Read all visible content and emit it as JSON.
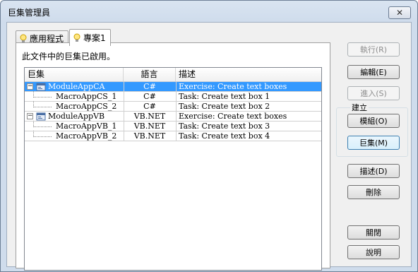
{
  "window": {
    "title": "巨集管理員"
  },
  "tabs": [
    {
      "label": "應用程式",
      "active": false
    },
    {
      "label": "專案1",
      "active": true
    }
  ],
  "status_text": "此文件中的巨集已啟用。",
  "columns": [
    "巨集",
    "語言",
    "描述"
  ],
  "rows": [
    {
      "name": "ModuleAppCA",
      "lang": "C#",
      "desc": "Exercise: Create text boxes",
      "level": 0,
      "selected": true
    },
    {
      "name": "MacroAppCS_1",
      "lang": "C#",
      "desc": "Task: Create text box 1",
      "level": 1,
      "selected": false
    },
    {
      "name": "MacroAppCS_2",
      "lang": "C#",
      "desc": "Task: Create text box 2",
      "level": 1,
      "selected": false
    },
    {
      "name": "ModuleAppVB",
      "lang": "VB.NET",
      "desc": "Exercise: Create text boxes",
      "level": 0,
      "selected": false
    },
    {
      "name": "MacroAppVB_1",
      "lang": "VB.NET",
      "desc": "Task: Create text box 3",
      "level": 1,
      "selected": false
    },
    {
      "name": "MacroAppVB_2",
      "lang": "VB.NET",
      "desc": "Task: Create text box 4",
      "level": 1,
      "selected": false
    }
  ],
  "buttons": {
    "run": "執行(R)",
    "edit": "編輯(E)",
    "step_into": "進入(S)",
    "create_group": "建立",
    "module": "模組(O)",
    "macro": "巨集(M)",
    "description": "描述(D)",
    "delete": "刪除",
    "close": "關閉",
    "help": "說明"
  },
  "colors": {
    "selection": "#3399ff",
    "titlebar": "#d9e4f1",
    "face": "#f0f0f0"
  }
}
